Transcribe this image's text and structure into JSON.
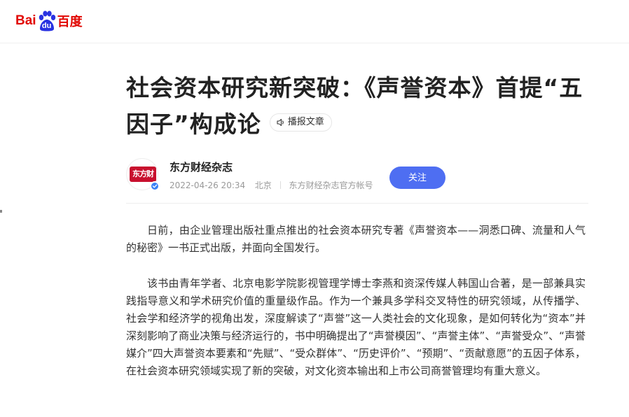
{
  "header": {
    "logo_bai": "Bai",
    "logo_du": "du",
    "logo_cn": "百度"
  },
  "article": {
    "title": "社会资本研究新突破：《声誉资本》首提“五因子”构成论",
    "tts_label": "播报文章"
  },
  "author": {
    "avatar_text": "东方财经",
    "name": "东方财经杂志",
    "datetime": "2022-04-26 20:34",
    "location": "北京",
    "account_type": "东方财经杂志官方帐号",
    "follow_label": "关注"
  },
  "content": {
    "paragraphs": [
      "日前，由企业管理出版社重点推出的社会资本研究专著《声誉资本——洞悉口碑、流量和人气的秘密》一书正式出版，并面向全国发行。",
      "该书由青年学者、北京电影学院影视管理学博士李燕和资深传媒人韩国山合著，是一部兼具实践指导意义和学术研究价值的重量级作品。作为一个兼具多学科交叉特性的研究领域，从传播学、社会学和经济学的视角出发，深度解读了“声誉”这一人类社会的文化现象，是如何转化为“资本”并深刻影响了商业决策与经济运行的，书中明确提出了“声誉模因”、“声誉主体”、“声誉受众”、“声誉媒介”四大声誉资本要素和“先赋”、“受众群体”、“历史评价”、“预期”、“贡献意愿”的五因子体系，在社会资本研究领域实现了新的突破，对文化资本输出和上市公司商誉管理均有重大意义。"
    ]
  },
  "colors": {
    "brand_red": "#e10601",
    "brand_blue": "#2932e1",
    "follow_blue": "#4e6ef2",
    "verified_blue": "#3b82f6"
  },
  "icons": [
    "baidu-paw-icon",
    "speaker-icon",
    "verified-icon"
  ]
}
